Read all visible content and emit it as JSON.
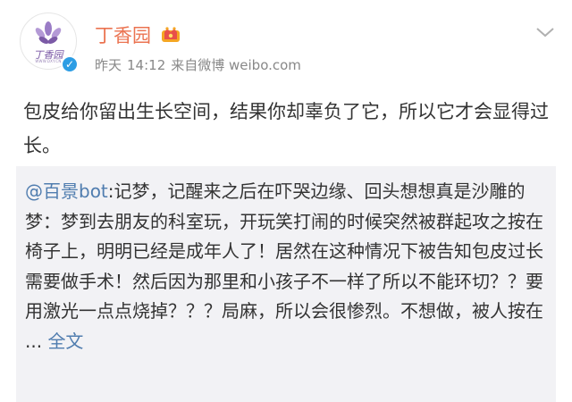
{
  "author": {
    "name": "丁香园",
    "avatar_text": "丁香园",
    "avatar_subtext": "WWW.DXY.CN",
    "verified_mark": "✓",
    "badge_icon": "crown-badge-icon",
    "accent_color": "#eb7350"
  },
  "meta": {
    "date": "昨天",
    "time": "14:12",
    "source": "来自微博 weibo.com"
  },
  "post": {
    "text": "包皮给你留出生长空间，结果你却辜负了它，所以它才会显得过长。"
  },
  "repost": {
    "mention": "@百景bot",
    "body": ":记梦，记醒来之后在吓哭边缘、回头想想真是沙雕的梦：梦到去朋友的科室玩，开玩笑打闹的时候突然被群起攻之按在椅子上，明明已经是成年人了！居然在这种情况下被告知包皮过长需要做手术！然后因为那里和小孩子不一样了所以不能环切？？要用激光一点点烧掉？？？局麻，所以会很惨烈。不想做，被人按在 ... ",
    "full_text_link": "全文",
    "link_color": "#507daf"
  },
  "icons": {
    "menu": "chevron-down-icon",
    "avatar_logo": "lilac-flower-icon"
  }
}
